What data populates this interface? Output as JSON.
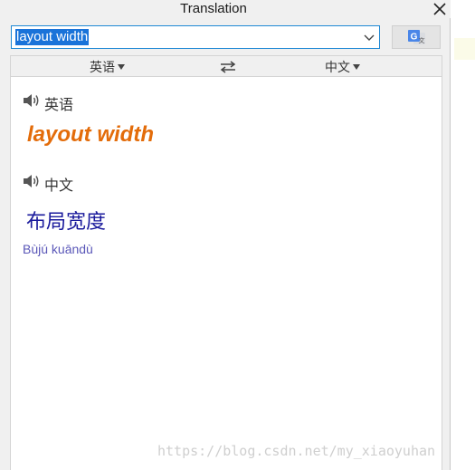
{
  "window": {
    "title": "Translation",
    "close_icon": "close-icon"
  },
  "search": {
    "value": "layout width",
    "dropdown_icon": "chevron-down-icon"
  },
  "translate_button": {
    "icon": "google-translate-icon"
  },
  "language_bar": {
    "source_lang": "英语",
    "target_lang": "中文",
    "swap_icon": "swap-arrows-icon"
  },
  "result": {
    "source": {
      "lang_label": "英语",
      "text": "layout width",
      "speaker_icon": "speaker-icon"
    },
    "target": {
      "lang_label": "中文",
      "text": "布局宽度",
      "pinyin": "Bùjú kuāndù",
      "speaker_icon": "speaker-icon"
    }
  },
  "watermark": "https://blog.csdn.net/my_xiaoyuhan",
  "colors": {
    "accent_border": "#1e88d4",
    "selection": "#1a73d9",
    "source_text": "#e36c0a",
    "target_text": "#1a1a9c",
    "pinyin": "#5a57b8"
  }
}
